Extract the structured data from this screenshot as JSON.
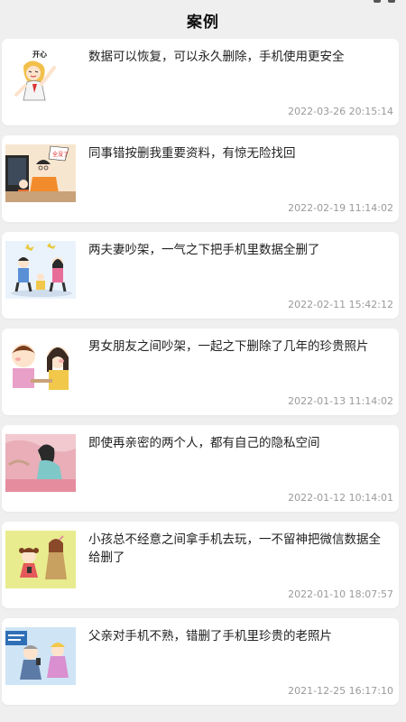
{
  "page": {
    "title": "案例"
  },
  "cases": [
    {
      "title": "数据可以恢复，可以永久删除，手机使用更安全",
      "date": "2022-03-26 20:15:14",
      "thumb_caption": "开心",
      "thumb_icon": "happy-woman-illustration"
    },
    {
      "title": "同事错按删我重要资料，有惊无险找回",
      "date": "2022-02-19 11:14:02",
      "thumb_caption": "全没了",
      "thumb_icon": "office-colleagues-illustration"
    },
    {
      "title": "两夫妻吵架，一气之下把手机里数据全删了",
      "date": "2022-02-11 15:42:12",
      "thumb_caption": "",
      "thumb_icon": "couple-argument-illustration"
    },
    {
      "title": "男女朋友之间吵架，一起之下删除了几年的珍贵照片",
      "date": "2022-01-13 11:14:02",
      "thumb_caption": "",
      "thumb_icon": "boyfriend-girlfriend-illustration"
    },
    {
      "title": "即使再亲密的两个人，都有自己的隐私空间",
      "date": "2022-01-12 10:14:01",
      "thumb_caption": "",
      "thumb_icon": "couple-in-bed-illustration"
    },
    {
      "title": "小孩总不经意之间拿手机去玩，一不留神把微信数据全给删了",
      "date": "2022-01-10 18:07:57",
      "thumb_caption": "",
      "thumb_icon": "child-with-phone-illustration"
    },
    {
      "title": "父亲对手机不熟，错删了手机里珍贵的老照片",
      "date": "2021-12-25 16:17:10",
      "thumb_caption": "",
      "thumb_icon": "father-with-phone-illustration"
    }
  ]
}
